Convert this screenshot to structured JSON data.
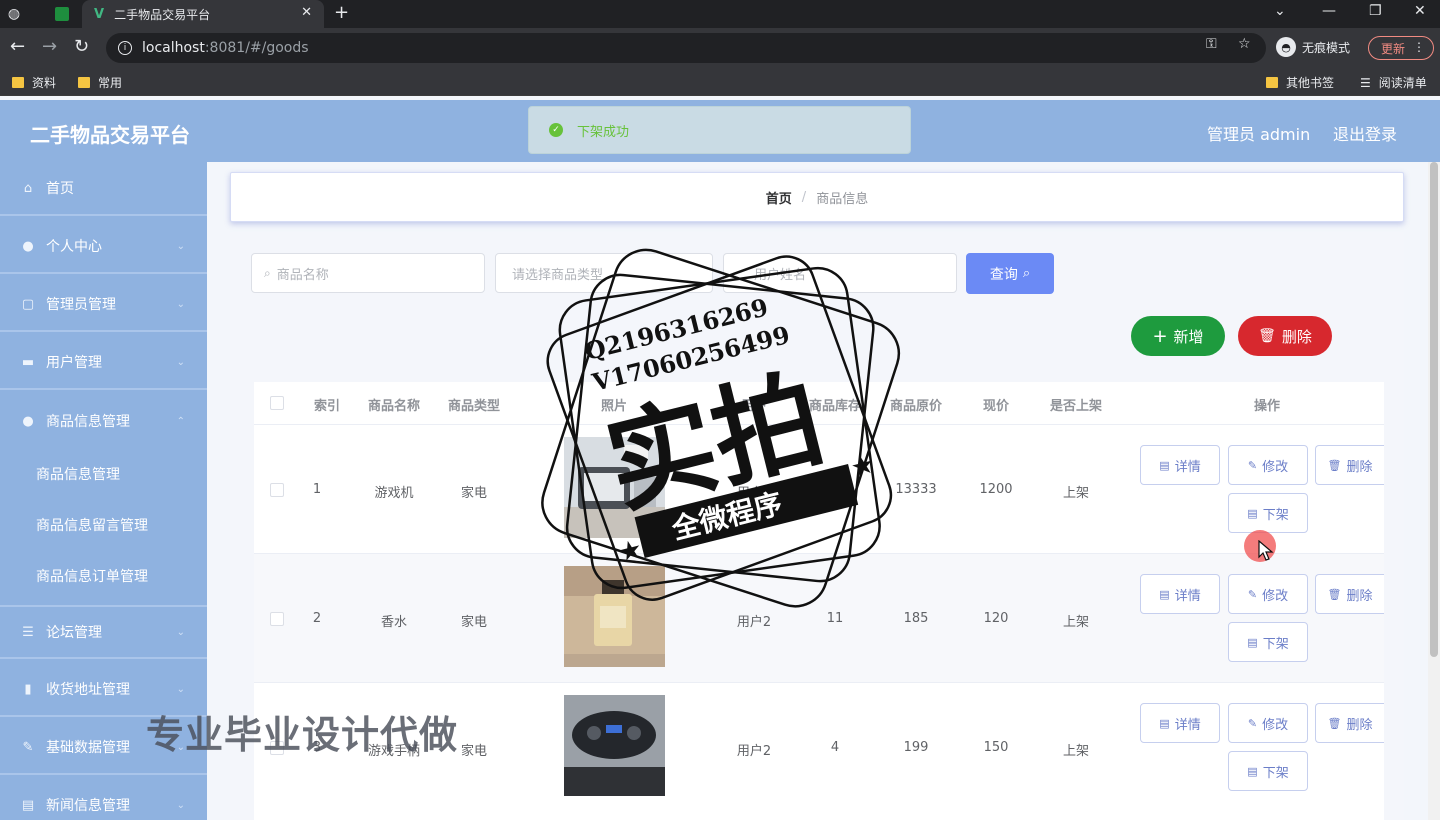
{
  "browser": {
    "tab_title": "二手物品交易平台",
    "url_host": "localhost",
    "url_path": ":8081/#/goods",
    "incognito_label": "无痕模式",
    "update_label": "更新",
    "bookmarks": [
      "资料",
      "常用"
    ],
    "bookmarks_right": [
      "其他书签",
      "阅读清单"
    ]
  },
  "header": {
    "title": "二手物品交易平台",
    "user": "管理员 admin",
    "logout": "退出登录"
  },
  "toast": {
    "message": "下架成功"
  },
  "sidebar": {
    "items": [
      {
        "label": "首页",
        "icon": "home-icon"
      },
      {
        "label": "个人中心",
        "icon": "user-icon"
      },
      {
        "label": "管理员管理",
        "icon": "square-icon"
      },
      {
        "label": "用户管理",
        "icon": "card-icon"
      },
      {
        "label": "商品信息管理",
        "icon": "user-icon"
      }
    ],
    "subitems": [
      "商品信息管理",
      "商品信息留言管理",
      "商品信息订单管理"
    ],
    "items_after": [
      {
        "label": "论坛管理",
        "icon": "list-icon"
      },
      {
        "label": "收货地址管理",
        "icon": "bar-icon"
      },
      {
        "label": "基础数据管理",
        "icon": "pen-icon"
      },
      {
        "label": "新闻信息管理",
        "icon": "news-icon"
      }
    ]
  },
  "breadcrumb": {
    "home": "首页",
    "separator": "/",
    "current": "商品信息"
  },
  "search": {
    "name_placeholder": "商品名称",
    "type_placeholder": "请选择商品类型",
    "user_placeholder": "用户姓名",
    "query_label": "查询"
  },
  "actions": {
    "add_label": "新增",
    "delete_label": "删除"
  },
  "table": {
    "headers": [
      "索引",
      "商品名称",
      "商品类型",
      "照片",
      "用户",
      "商品库存",
      "商品原价",
      "现价",
      "是否上架",
      "操作"
    ],
    "rows": [
      {
        "index": "1",
        "name": "游戏机",
        "type": "家电",
        "user": "用户2",
        "stock": "10",
        "original_price": "13333",
        "price": "1200",
        "status": "上架"
      },
      {
        "index": "2",
        "name": "香水",
        "type": "家电",
        "user": "用户2",
        "stock": "11",
        "original_price": "185",
        "price": "120",
        "status": "上架"
      },
      {
        "index": "3",
        "name": "游戏手柄",
        "type": "家电",
        "user": "用户2",
        "stock": "4",
        "original_price": "199",
        "price": "150",
        "status": "上架"
      }
    ],
    "op_labels": {
      "detail": "详情",
      "edit": "修改",
      "delete": "删除",
      "offshelf": "下架"
    }
  },
  "overlay": {
    "stamp_contact_q": "Q2196316269",
    "stamp_contact_v": "V17060256499",
    "stamp_main": "实拍",
    "stamp_banner": "全微程序",
    "promo_text": "专业毕业设计代做"
  },
  "colors": {
    "header_bg": "#8fb2e0",
    "primary": "#6b8af5",
    "success": "#1e9b3e",
    "danger": "#d7282e"
  }
}
